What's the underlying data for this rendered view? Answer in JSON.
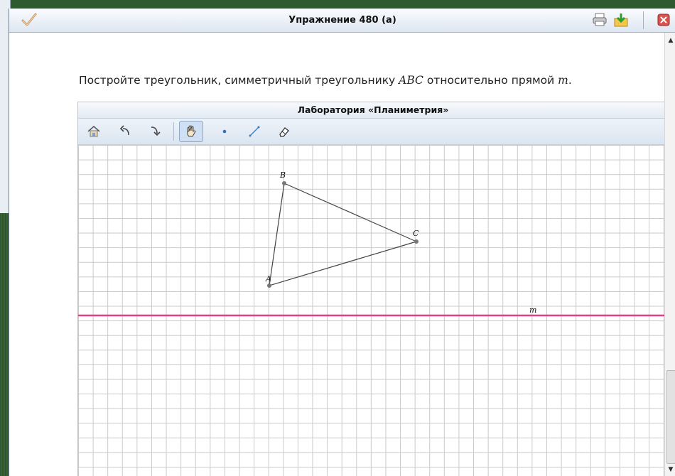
{
  "window": {
    "title": "Упражнение 480 (а)",
    "icons": {
      "app": "checkmark-icon",
      "print": "printer-icon",
      "download": "download-icon",
      "close": "close-icon"
    }
  },
  "task": {
    "text_before": "Постройте треугольник, симметричный треугольнику ",
    "triangle_name": "ABC",
    "text_middle": " относительно прямой ",
    "line_name": "m",
    "text_after": "."
  },
  "lab": {
    "title": "Лаборатория «Планиметрия»",
    "tools": [
      {
        "name": "home-icon",
        "glyph": "⌂"
      },
      {
        "name": "undo-icon",
        "glyph": "↶"
      },
      {
        "name": "redo-icon",
        "glyph": "↷"
      },
      {
        "name": "hand-icon",
        "glyph": "✋",
        "active": true
      },
      {
        "name": "point-icon",
        "glyph": "•"
      },
      {
        "name": "segment-icon",
        "glyph": "⁄"
      },
      {
        "name": "eraser-icon",
        "glyph": "⌫"
      }
    ],
    "points": {
      "A": "A",
      "B": "B",
      "C": "C"
    },
    "line_label": "m",
    "colors": {
      "line_m": "#e0408a",
      "triangle": "#444444",
      "points": "#777777"
    }
  }
}
